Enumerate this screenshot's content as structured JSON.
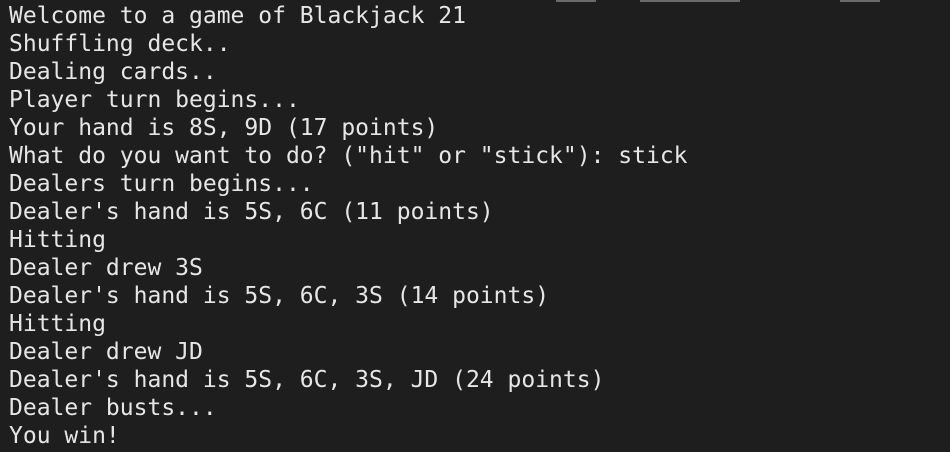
{
  "terminal": {
    "background": "#1e1e1e",
    "foreground": "#e6e6e6",
    "lines": [
      "Welcome to a game of Blackjack 21",
      "Shuffling deck..",
      "Dealing cards..",
      "Player turn begins...",
      "Your hand is 8S, 9D (17 points)",
      "What do you want to do? (\"hit\" or \"stick\"): stick",
      "Dealers turn begins...",
      "Dealer's hand is 5S, 6C (11 points)",
      "Hitting",
      "Dealer drew 3S",
      "Dealer's hand is 5S, 6C, 3S (14 points)",
      "Hitting",
      "Dealer drew JD",
      "Dealer's hand is 5S, 6C, 3S, JD (24 points)",
      "Dealer busts...",
      "You win!"
    ]
  }
}
